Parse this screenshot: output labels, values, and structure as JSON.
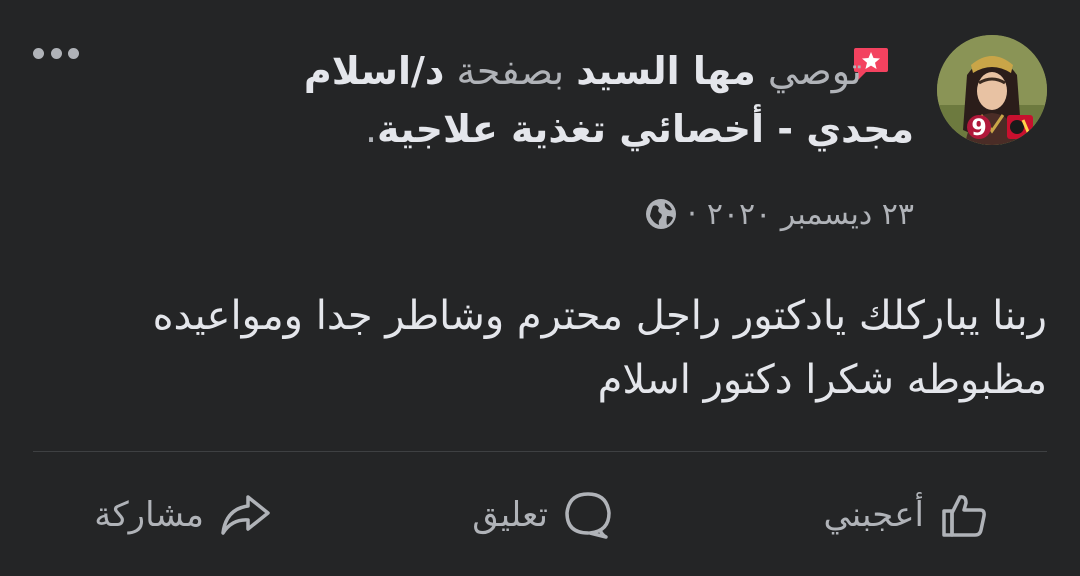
{
  "post": {
    "author_name": "مها السيد",
    "recommends_text": "توصي",
    "page_prefix": "بصفحة",
    "page_name": "د/اسلام مجدي - أخصائي تغذية علاجية",
    "title_end": ".",
    "date": "٢٣ ديسمبر ٢٠٢٠",
    "separator": "·",
    "privacy_icon": "globe-icon",
    "badge_icon": "recommendation-star-icon",
    "more_icon": "more-options-icon",
    "body": "ربنا يباركلك يادكتور راجل محترم وشاطر جدا ومواعيده مظبوطه شكرا دكتور اسلام"
  },
  "actions": {
    "like_label": "أعجبني",
    "comment_label": "تعليق",
    "share_label": "مشاركة"
  },
  "colors": {
    "background": "#242526",
    "text_primary": "#e4e6eb",
    "text_secondary": "#b0b3b8",
    "badge": "#f3425f",
    "divider": "#3e4042"
  }
}
